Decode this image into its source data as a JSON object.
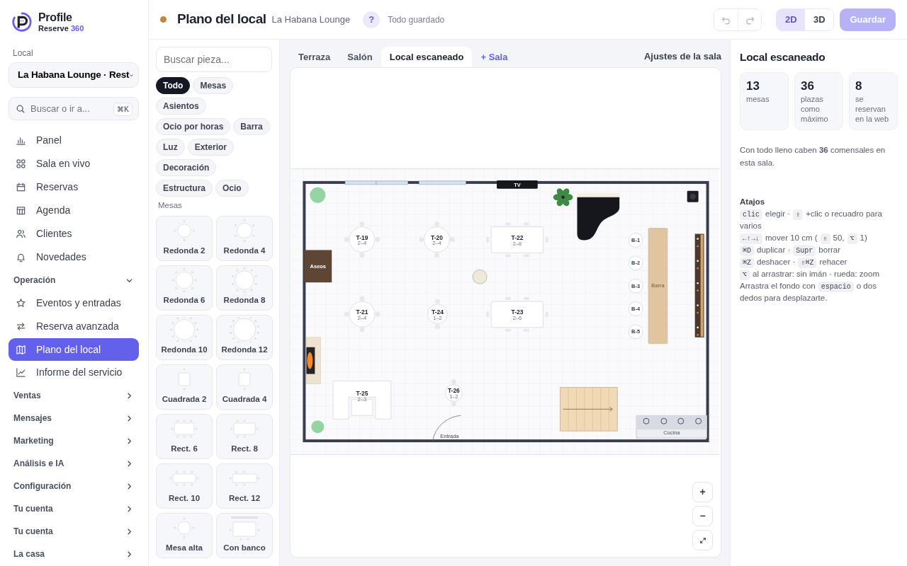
{
  "sidebar": {
    "brand": {
      "name": "Profile",
      "product": "Reserve",
      "version": "360"
    },
    "venue": {
      "label": "Local",
      "value": "La Habana Lounge · Rest"
    },
    "search": {
      "placeholder": "Buscar o ir a...",
      "shortcut": "⌘K"
    },
    "items": [
      {
        "label": "Panel",
        "selected": false
      },
      {
        "label": "Sala en vivo",
        "selected": false
      },
      {
        "label": "Reservas",
        "selected": false
      },
      {
        "label": "Agenda",
        "selected": false
      },
      {
        "label": "Clientes",
        "selected": false
      },
      {
        "label": "Novedades",
        "selected": false
      }
    ],
    "groups": [
      {
        "label": "Operación",
        "expanded": true,
        "items": [
          {
            "label": "Eventos y entradas",
            "selected": false
          },
          {
            "label": "Reserva avanzada",
            "selected": false
          },
          {
            "label": "Plano del local",
            "selected": true
          },
          {
            "label": "Informe del servicio",
            "selected": false
          }
        ]
      },
      {
        "label": "Ventas",
        "expanded": false
      },
      {
        "label": "Mensajes",
        "expanded": false
      },
      {
        "label": "Marketing",
        "expanded": false
      },
      {
        "label": "Análisis e IA",
        "expanded": false
      },
      {
        "label": "Configuración",
        "expanded": false
      },
      {
        "label": "Tu cuenta",
        "expanded": false
      },
      {
        "label": "Tu cuenta",
        "expanded": false
      },
      {
        "label": "La casa",
        "expanded": false
      }
    ]
  },
  "header": {
    "title": "Plano del local",
    "venue": "La Habana Lounge",
    "help": "?",
    "save_status": "Todo guardado",
    "undo": {
      "disabled": true
    },
    "redo": {
      "disabled": true
    },
    "view_modes": [
      {
        "label": "2D",
        "selected": true
      },
      {
        "label": "3D",
        "selected": false
      }
    ],
    "save": {
      "label": "Guardar",
      "disabled": true
    }
  },
  "palette": {
    "search": {
      "placeholder": "Buscar pieza..."
    },
    "filters": [
      {
        "label": "Todo",
        "selected": true
      },
      {
        "label": "Mesas",
        "selected": false
      },
      {
        "label": "Asientos",
        "selected": false
      },
      {
        "label": "Ocio por horas",
        "selected": false
      },
      {
        "label": "Barra",
        "selected": false
      },
      {
        "label": "Luz",
        "selected": false
      },
      {
        "label": "Exterior",
        "selected": false
      },
      {
        "label": "Decoración",
        "selected": false
      },
      {
        "label": "Estructura",
        "selected": false
      },
      {
        "label": "Ocio",
        "selected": false
      }
    ],
    "section": "Mesas",
    "pieces": [
      {
        "label": "Redonda 2",
        "kind": "round"
      },
      {
        "label": "Redonda 4",
        "kind": "round"
      },
      {
        "label": "Redonda 6",
        "kind": "round"
      },
      {
        "label": "Redonda 8",
        "kind": "round"
      },
      {
        "label": "Redonda 10",
        "kind": "round"
      },
      {
        "label": "Redonda 12",
        "kind": "round"
      },
      {
        "label": "Cuadrada 2",
        "kind": "square"
      },
      {
        "label": "Cuadrada 4",
        "kind": "square"
      },
      {
        "label": "Rect. 6",
        "kind": "rect"
      },
      {
        "label": "Rect. 8",
        "kind": "rect"
      },
      {
        "label": "Rect. 10",
        "kind": "rect"
      },
      {
        "label": "Rect. 12",
        "kind": "rect"
      },
      {
        "label": "Mesa alta",
        "kind": "high"
      },
      {
        "label": "Con banco",
        "kind": "bench"
      }
    ]
  },
  "canvas": {
    "tabs": [
      {
        "label": "Terraza",
        "kind": "room",
        "selected": false
      },
      {
        "label": "Salón",
        "kind": "room",
        "selected": false
      },
      {
        "label": "Local escaneado",
        "kind": "room",
        "selected": true
      }
    ],
    "add_room": "+ Sala",
    "settings_link": "Ajustes de la sala",
    "floor_plan": {
      "tables": [
        {
          "label": "T-19",
          "capacity": "2–4",
          "kind": "round"
        },
        {
          "label": "T-20",
          "capacity": "2–4",
          "kind": "round"
        },
        {
          "label": "T-22",
          "capacity": "2–6",
          "kind": "rect"
        },
        {
          "label": "T-21",
          "capacity": "2–4",
          "kind": "round"
        },
        {
          "label": "T-24",
          "capacity": "1–2",
          "kind": "round"
        },
        {
          "label": "T-23",
          "capacity": "2–6",
          "kind": "rect"
        },
        {
          "label": "T-25",
          "capacity": "2–3",
          "kind": "booth"
        },
        {
          "label": "T-26",
          "capacity": "1–2",
          "kind": "round"
        }
      ],
      "stools": [
        {
          "label": "B-1"
        },
        {
          "label": "B-2"
        },
        {
          "label": "B-3"
        },
        {
          "label": "B-4"
        },
        {
          "label": "B-5"
        }
      ],
      "zones": [
        {
          "kind": "restroom",
          "label": "Aseos"
        },
        {
          "kind": "tv",
          "label": "TV"
        },
        {
          "kind": "bar",
          "label": "Barra"
        },
        {
          "kind": "kitchen",
          "label": "Cocina"
        },
        {
          "kind": "entrance",
          "label": "Entrada"
        }
      ]
    },
    "zoom": {
      "zoom_in": "+",
      "zoom_out": "−"
    }
  },
  "panel": {
    "title": "Local escaneado",
    "stats": [
      {
        "value": "13",
        "label": "mesas"
      },
      {
        "value": "36",
        "label": "plazas como máximo"
      },
      {
        "value": "8",
        "label": "se reservan en la web"
      }
    ],
    "summary": "Con todo lleno caben **36** comensales en esta sala.",
    "shortcuts": {
      "title": "Atajos",
      "lines": [
        {
          "parts": [
            {
              "kind": "key",
              "text": "clic"
            },
            {
              "kind": "text",
              "text": "elegir ·"
            },
            {
              "kind": "key",
              "text": "⇧"
            },
            {
              "kind": "text",
              "text": "+clic o recuadro para"
            },
            {
              "kind": "text",
              "text": "varios"
            }
          ]
        },
        {
          "parts": [
            {
              "kind": "key",
              "text": "←↑→↓"
            },
            {
              "kind": "text",
              "text": "mover 10 cm ("
            },
            {
              "kind": "key",
              "text": "⇧"
            },
            {
              "kind": "text",
              "text": "50,"
            },
            {
              "kind": "key",
              "text": "⌥"
            },
            {
              "kind": "text",
              "text": "1)"
            }
          ]
        },
        {
          "parts": [
            {
              "kind": "key",
              "text": "⌘D"
            },
            {
              "kind": "text",
              "text": "duplicar ·"
            },
            {
              "kind": "key",
              "text": "Supr"
            },
            {
              "kind": "text",
              "text": "borrar"
            }
          ]
        },
        {
          "parts": [
            {
              "kind": "key",
              "text": "⌘Z"
            },
            {
              "kind": "text",
              "text": "deshacer ·"
            },
            {
              "kind": "key",
              "text": "⇧⌘Z"
            },
            {
              "kind": "text",
              "text": "rehacer"
            }
          ]
        },
        {
          "parts": [
            {
              "kind": "key",
              "text": "⌥"
            },
            {
              "kind": "text",
              "text": "al arrastrar: sin imán · rueda: zoom"
            }
          ]
        },
        {
          "parts": [
            {
              "kind": "text",
              "text": "Arrastra el fondo con"
            },
            {
              "kind": "key",
              "text": "espacio"
            },
            {
              "kind": "text",
              "text": "o dos"
            },
            {
              "kind": "text",
              "text": "dedos para desplazarte."
            }
          ]
        }
      ]
    }
  }
}
